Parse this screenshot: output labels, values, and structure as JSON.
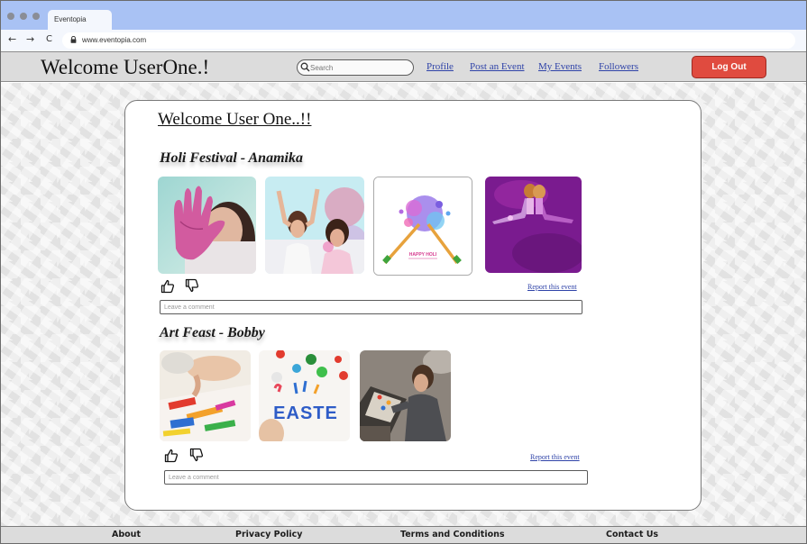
{
  "browser": {
    "tab_title": "Eventopia",
    "url": "www.eventopia.com",
    "back_icon": "←",
    "forward_icon": "→",
    "reload_icon": "C"
  },
  "header": {
    "welcome": "Welcome UserOne.!",
    "search_placeholder": "Search",
    "nav": [
      "Profile",
      "Post an Event",
      "My Events",
      "Followers"
    ],
    "logout_label": "Log Out"
  },
  "main": {
    "title": "Welcome User One..!!",
    "events": [
      {
        "title": "Holi Festival  - Anamika",
        "photos": [
          "holi-hand-photo",
          "holi-celebration-photo",
          "happy-holi-graphic",
          "holi-couple-photo"
        ],
        "graphic_text": "HAPPY HOLI",
        "report_label": "Report this event",
        "comment_placeholder": "Leave a comment"
      },
      {
        "title": "Art Feast - Bobby",
        "photos": [
          "painting-hands-photo",
          "easter-lettering-photo",
          "artist-at-table-photo"
        ],
        "graphic_text": "EASTE",
        "report_label": "Report this event",
        "comment_placeholder": "Leave a comment"
      }
    ]
  },
  "footer": {
    "links": [
      "About",
      "Privacy Policy",
      "Terms and Conditions",
      "Contact Us"
    ]
  },
  "colors": {
    "browser_chrome": "#a9c2f4",
    "header_bg": "#dcdcdc",
    "logout_red": "#e04b3f",
    "link_blue": "#2f43a8"
  },
  "icons": {
    "like": "thumbs-up-icon",
    "dislike": "thumbs-down-icon",
    "search": "search-icon",
    "lock": "lock-icon"
  }
}
